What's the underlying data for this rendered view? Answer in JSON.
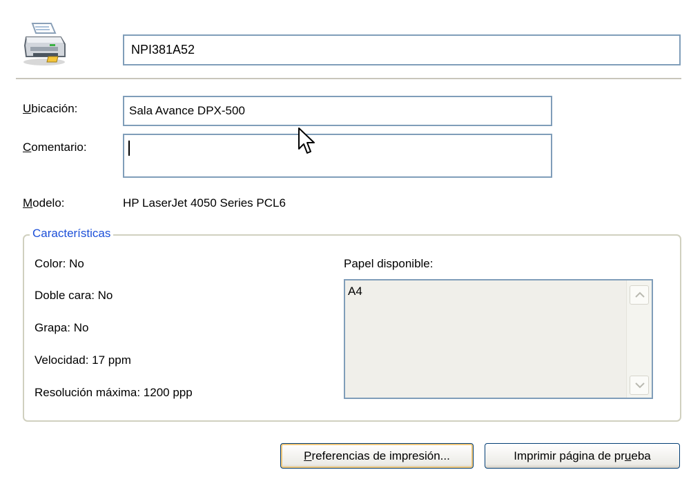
{
  "printer": {
    "icon": "printer-icon",
    "name": "NPI381A52"
  },
  "fields": {
    "location_label_mnemonic": "U",
    "location_label_rest": "bicación:",
    "location_value": "Sala Avance DPX-500",
    "comment_label_mnemonic": "C",
    "comment_label_rest": "omentario:",
    "comment_value": "",
    "model_label_mnemonic": "M",
    "model_label_rest": "odelo:",
    "model_value": "HP LaserJet 4050 Series PCL6"
  },
  "features": {
    "legend": "Características",
    "color": "Color: No",
    "duplex": "Doble cara: No",
    "staple": "Grapa: No",
    "speed": "Velocidad: 17 ppm",
    "resolution": "Resolución máxima: 1200 ppp",
    "paper_label": "Papel disponible:",
    "paper_items": [
      "A4"
    ]
  },
  "buttons": {
    "preferences_mnemonic": "P",
    "preferences_rest": "referencias de impresión...",
    "test_page_before": "Imprimir página de pr",
    "test_page_mnemonic": "u",
    "test_page_after": "eba"
  },
  "colors": {
    "accent": "#1c4fd8",
    "textbox_border": "#7f9db9",
    "button_border": "#003c74"
  }
}
